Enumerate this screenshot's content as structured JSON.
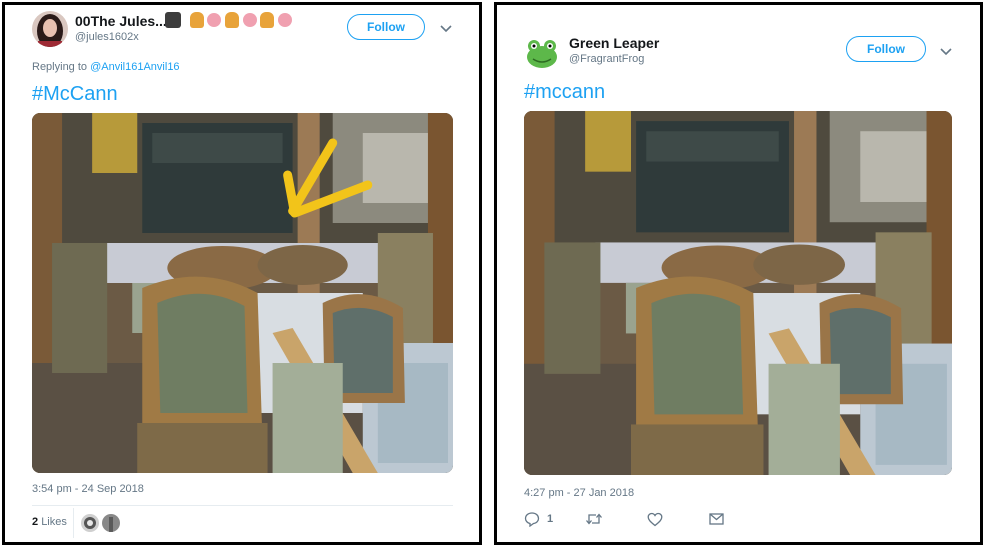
{
  "left_tweet": {
    "display_name": "00The Jules...",
    "name_emojis": [
      "detective-emoji",
      "raising-hand-emoji",
      "blossom-emoji",
      "raising-hand-emoji",
      "blossom-emoji",
      "raising-hand-emoji",
      "blossom-emoji"
    ],
    "handle": "@jules1602x",
    "follow_label": "Follow",
    "replying_prefix": "Replying to",
    "replying_to": "@Anvil161Anvil16",
    "hashtag": "#McCann",
    "timestamp": "3:54 pm - 24 Sep 2018",
    "likes_count": "2",
    "likes_label": "Likes",
    "annotation_color": "#f2c41a"
  },
  "right_tweet": {
    "display_name": "Green Leaper",
    "handle": "@FragrantFrog",
    "follow_label": "Follow",
    "hashtag": "#mccann",
    "timestamp": "4:27 pm - 27 Jan 2018",
    "reply_count": "1",
    "actions": [
      "reply-icon",
      "retweet-icon",
      "like-icon",
      "message-icon"
    ]
  },
  "colors": {
    "accent": "#1da1f2",
    "muted": "#657786",
    "text": "#14171a"
  }
}
